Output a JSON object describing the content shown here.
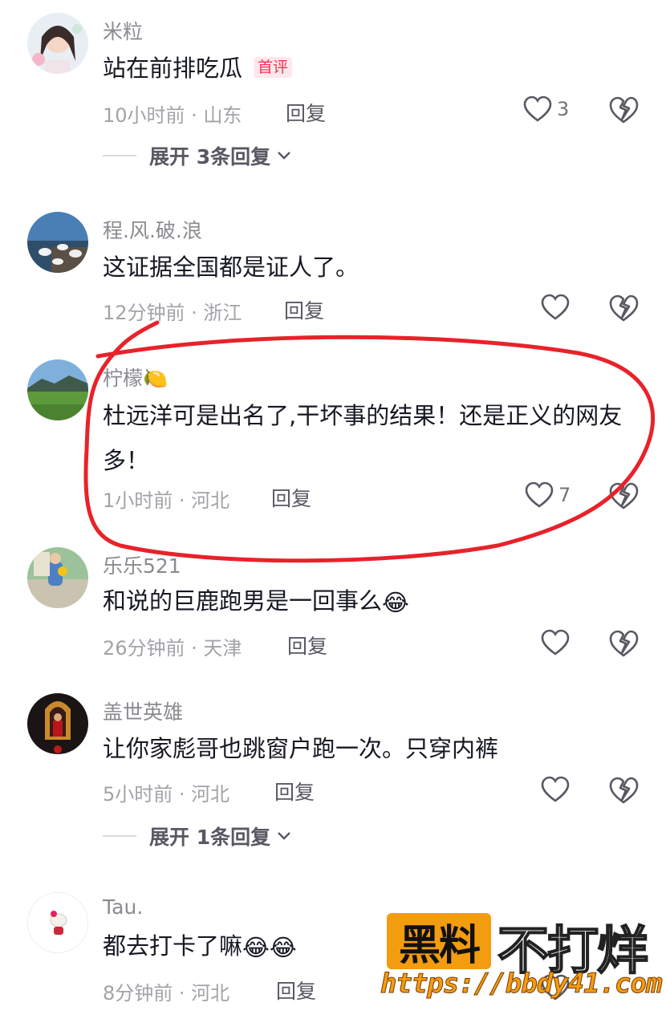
{
  "comments": [
    {
      "username": "米粒",
      "text": "站在前排吃瓜",
      "tag": "首评",
      "meta": "10小时前 · 山东",
      "reply_label": "回复",
      "like_count": "3",
      "expand_label": "展开 3条回复"
    },
    {
      "username": "程.风.破.浪",
      "text": "这证据全国都是证人了。",
      "meta": "12分钟前 · 浙江",
      "reply_label": "回复",
      "like_count": ""
    },
    {
      "username": "柠檬🍋",
      "text": "杜远洋可是出名了,干坏事的结果！还是正义的网友多！",
      "meta": "1小时前 · 河北",
      "reply_label": "回复",
      "like_count": "7"
    },
    {
      "username": "乐乐521",
      "text": "和说的巨鹿跑男是一回事么",
      "emoji": "😂",
      "meta": "26分钟前 · 天津",
      "reply_label": "回复",
      "like_count": ""
    },
    {
      "username": "盖世英雄",
      "text": "让你家彪哥也跳窗户跑一次。只穿内裤",
      "meta": "5小时前 · 河北",
      "reply_label": "回复",
      "like_count": "",
      "expand_label": "展开 1条回复"
    },
    {
      "username": "Tau.",
      "text": "都去打卡了嘛",
      "emoji": "😂😂",
      "meta": "8分钟前 · 河北",
      "reply_label": "回复",
      "like_count": ""
    }
  ],
  "watermark": {
    "box_text": "黑料",
    "right_text": "不打烊",
    "url": "https://bbdy41.com"
  },
  "colors": {
    "annotation": "#e8222a",
    "tag_text": "#fe2c55",
    "watermark_orange": "#f39c0f"
  }
}
